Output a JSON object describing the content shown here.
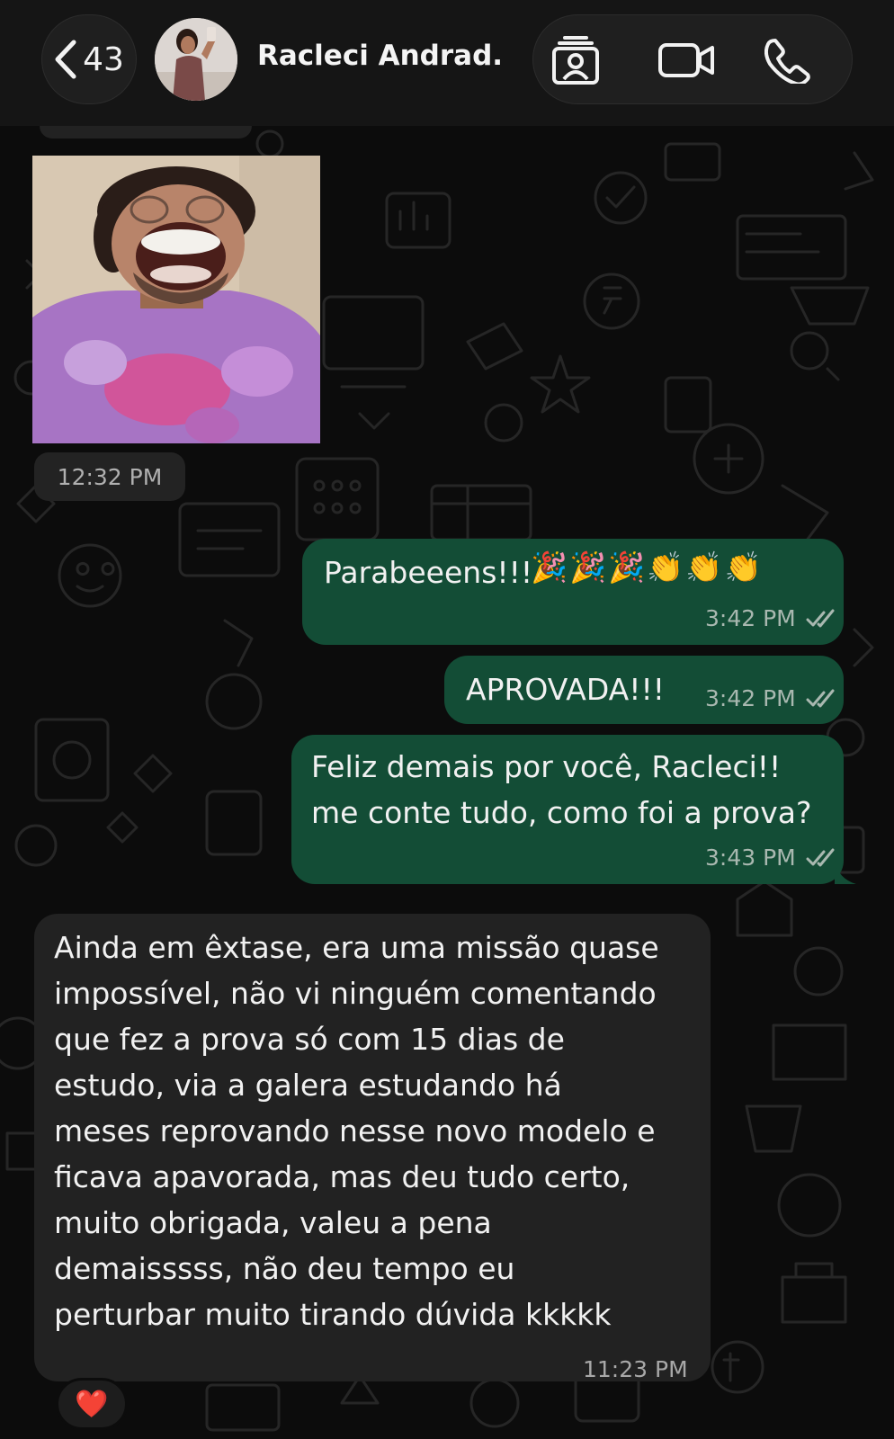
{
  "header": {
    "back_count": "43",
    "contact_name": "Racleci Andrad...",
    "icons": [
      "chevron-left-icon",
      "contact-card-icon",
      "video-call-icon",
      "phone-call-icon"
    ]
  },
  "sticker": {
    "description_icon": "sticker-image"
  },
  "sticker_time": "12:32 PM",
  "messages": [
    {
      "direction": "out",
      "text": "Parabeeens!!!",
      "emojis": "🎉🎉🎉👏👏👏",
      "time": "3:42 PM",
      "status": "read"
    },
    {
      "direction": "out",
      "text": "APROVADA!!!",
      "time": "3:42 PM",
      "status": "read"
    },
    {
      "direction": "out",
      "text": "Feliz demais por você, Racleci!!\nme conte tudo, como foi a prova?",
      "time": "3:43 PM",
      "status": "read"
    },
    {
      "direction": "in",
      "text": "Ainda em êxtase, era uma missão quase\nimpossível, não vi ninguém comentando\nque fez a prova só com 15 dias de\nestudo, via a galera estudando há\nmeses reprovando nesse novo modelo e\nficava apavorada, mas deu tudo certo,\nmuito obrigada, valeu a pena\ndemaisssss, não deu tempo eu\nperturbar muito tirando dúvida kkkkk",
      "time": "11:23 PM",
      "reaction": "❤️"
    }
  ],
  "colors": {
    "outgoing_bubble": "#134d36",
    "incoming_bubble": "#222222",
    "background": "#0c0c0c",
    "read_ticks": "#a9b8b0"
  }
}
